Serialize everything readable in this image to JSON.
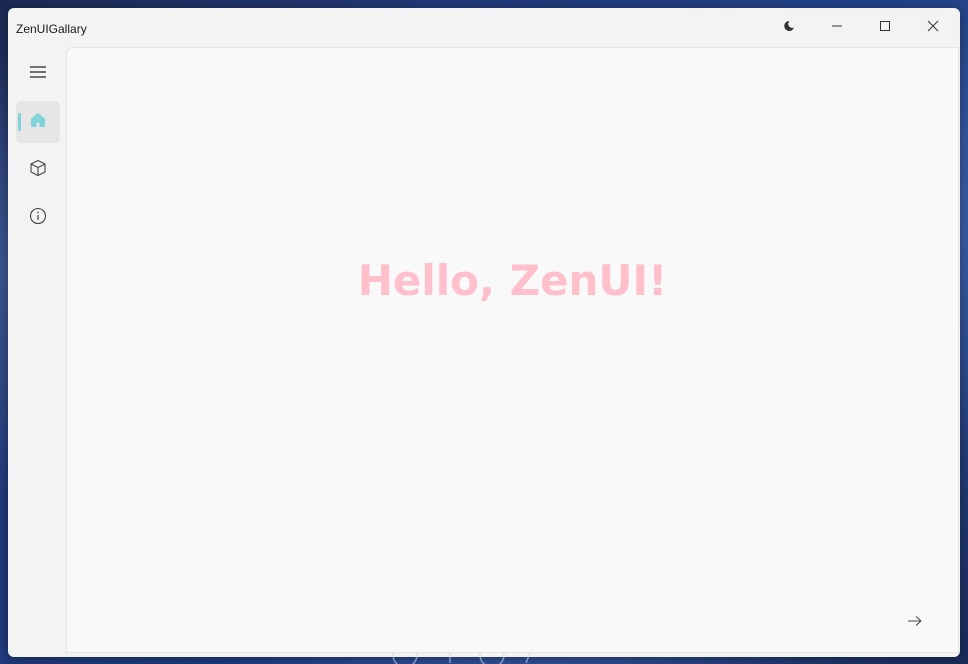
{
  "window": {
    "title": "ZenUIGallary"
  },
  "titlebar": {
    "theme_icon": "moon-icon",
    "minimize_icon": "minimize-icon",
    "maximize_icon": "maximize-icon",
    "close_icon": "close-icon"
  },
  "sidebar": {
    "items": [
      {
        "name": "menu",
        "icon": "hamburger-menu-icon",
        "active": false
      },
      {
        "name": "home",
        "icon": "home-icon",
        "active": true
      },
      {
        "name": "components",
        "icon": "cube-icon",
        "active": false
      },
      {
        "name": "about",
        "icon": "info-icon",
        "active": false
      }
    ]
  },
  "main": {
    "heading": "Hello, ZenUI!",
    "next_icon": "arrow-right-icon"
  },
  "colors": {
    "accent": "#7fd3d9",
    "heading": "#ffc0cb",
    "window_bg": "#f3f3f3",
    "content_bg": "#f9f9f9"
  }
}
